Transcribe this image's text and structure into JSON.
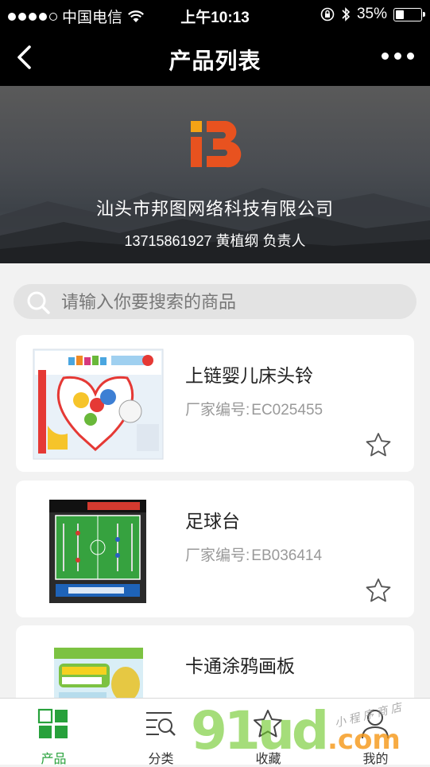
{
  "status_bar": {
    "carrier": "中国电信",
    "time": "上午10:13",
    "battery": "35%",
    "battery_level": 0.35
  },
  "nav": {
    "title": "产品列表"
  },
  "banner": {
    "company": "汕头市邦图网络科技有限公司",
    "contact": "13715861927 黄植纲 负责人"
  },
  "search": {
    "placeholder": "请输入你要搜索的商品"
  },
  "products": [
    {
      "title": "上链婴儿床头铃",
      "code_label": "厂家编号:",
      "code": "EC025455"
    },
    {
      "title": "足球台",
      "code_label": "厂家编号:",
      "code": "EB036414"
    },
    {
      "title": "卡通涂鸦画板"
    }
  ],
  "tabs": [
    {
      "label": "产品",
      "icon": "grid-icon",
      "active": true
    },
    {
      "label": "分类",
      "icon": "list-search-icon",
      "active": false
    },
    {
      "label": "收藏",
      "icon": "star-icon",
      "active": false
    },
    {
      "label": "我的",
      "icon": "person-icon",
      "active": false
    }
  ],
  "colors": {
    "accent": "#27a13b",
    "logo": "#e8521f",
    "logo_dot": "#f5a315"
  }
}
